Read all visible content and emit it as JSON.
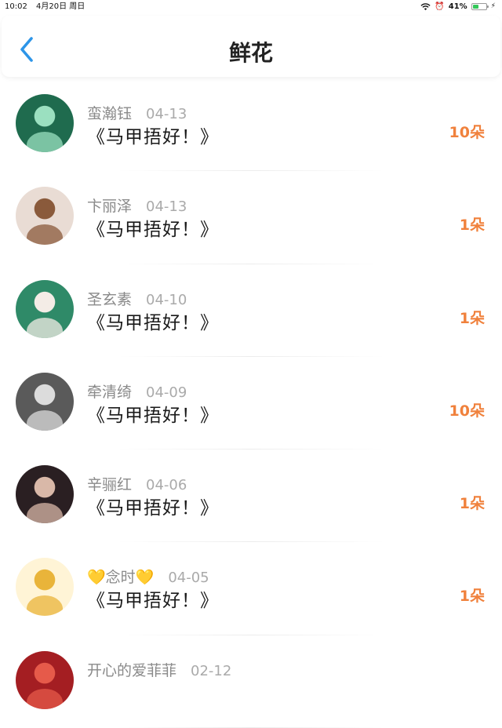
{
  "status": {
    "time": "10:02",
    "date": "4月20日 周日",
    "battery": "41%",
    "battery_fraction": 0.41
  },
  "nav": {
    "title": "鲜花"
  },
  "items": [
    {
      "name": "蛮瀚钰",
      "date": "04-13",
      "book": "《马甲捂好！》",
      "count": "10朵",
      "avatar": {
        "bg": "#1f6b4e",
        "fg": "#9be0c0"
      }
    },
    {
      "name": "卞丽泽",
      "date": "04-13",
      "book": "《马甲捂好！》",
      "count": "1朵",
      "avatar": {
        "bg": "#e9dcd4",
        "fg": "#8a5a3b"
      }
    },
    {
      "name": "圣玄素",
      "date": "04-10",
      "book": "《马甲捂好！》",
      "count": "1朵",
      "avatar": {
        "bg": "#2f8a68",
        "fg": "#f4ece6"
      }
    },
    {
      "name": "牵清绮",
      "date": "04-09",
      "book": "《马甲捂好！》",
      "count": "10朵",
      "avatar": {
        "bg": "#5a5a5a",
        "fg": "#dcdcdc"
      }
    },
    {
      "name": "辛骊红",
      "date": "04-06",
      "book": "《马甲捂好！》",
      "count": "1朵",
      "avatar": {
        "bg": "#2a1f22",
        "fg": "#d9b8a8"
      }
    },
    {
      "name": "💛念时💛",
      "date": "04-05",
      "book": "《马甲捂好！》",
      "count": "1朵",
      "avatar": {
        "bg": "#fff4d6",
        "fg": "#e9b43a"
      }
    },
    {
      "name": "开心的爱菲菲",
      "date": "02-12",
      "book": "",
      "count": "",
      "avatar": {
        "bg": "#a41e22",
        "fg": "#e65a4a"
      }
    }
  ]
}
